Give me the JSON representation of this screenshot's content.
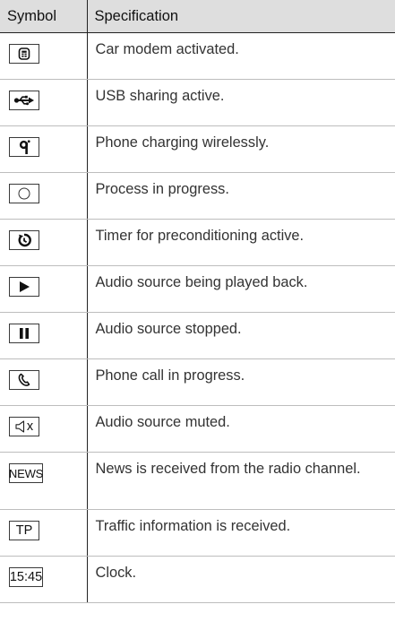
{
  "table": {
    "header_symbol": "Symbol",
    "header_specification": "Specification",
    "rows": [
      {
        "icon": "car-modem-icon",
        "spec": "Car modem activated."
      },
      {
        "icon": "usb-icon",
        "spec": "USB sharing active."
      },
      {
        "icon": "wireless-charging-icon",
        "spec": "Phone charging wirelessly."
      },
      {
        "icon": "process-icon",
        "spec": "Process in progress."
      },
      {
        "icon": "timer-icon",
        "spec": "Timer for preconditioning active."
      },
      {
        "icon": "play-icon",
        "spec": "Audio source being played back."
      },
      {
        "icon": "pause-icon",
        "spec": "Audio source stopped."
      },
      {
        "icon": "phone-icon",
        "spec": "Phone call in progress."
      },
      {
        "icon": "mute-icon",
        "spec": "Audio source muted.",
        "icon_text": "x"
      },
      {
        "icon": "news-icon",
        "spec": "News is received from the radio channel.",
        "icon_text": "NEWS"
      },
      {
        "icon": "tp-icon",
        "spec": "Traffic information is received.",
        "icon_text": "TP"
      },
      {
        "icon": "clock-icon",
        "spec": "Clock.",
        "icon_text": "15:45"
      }
    ]
  }
}
